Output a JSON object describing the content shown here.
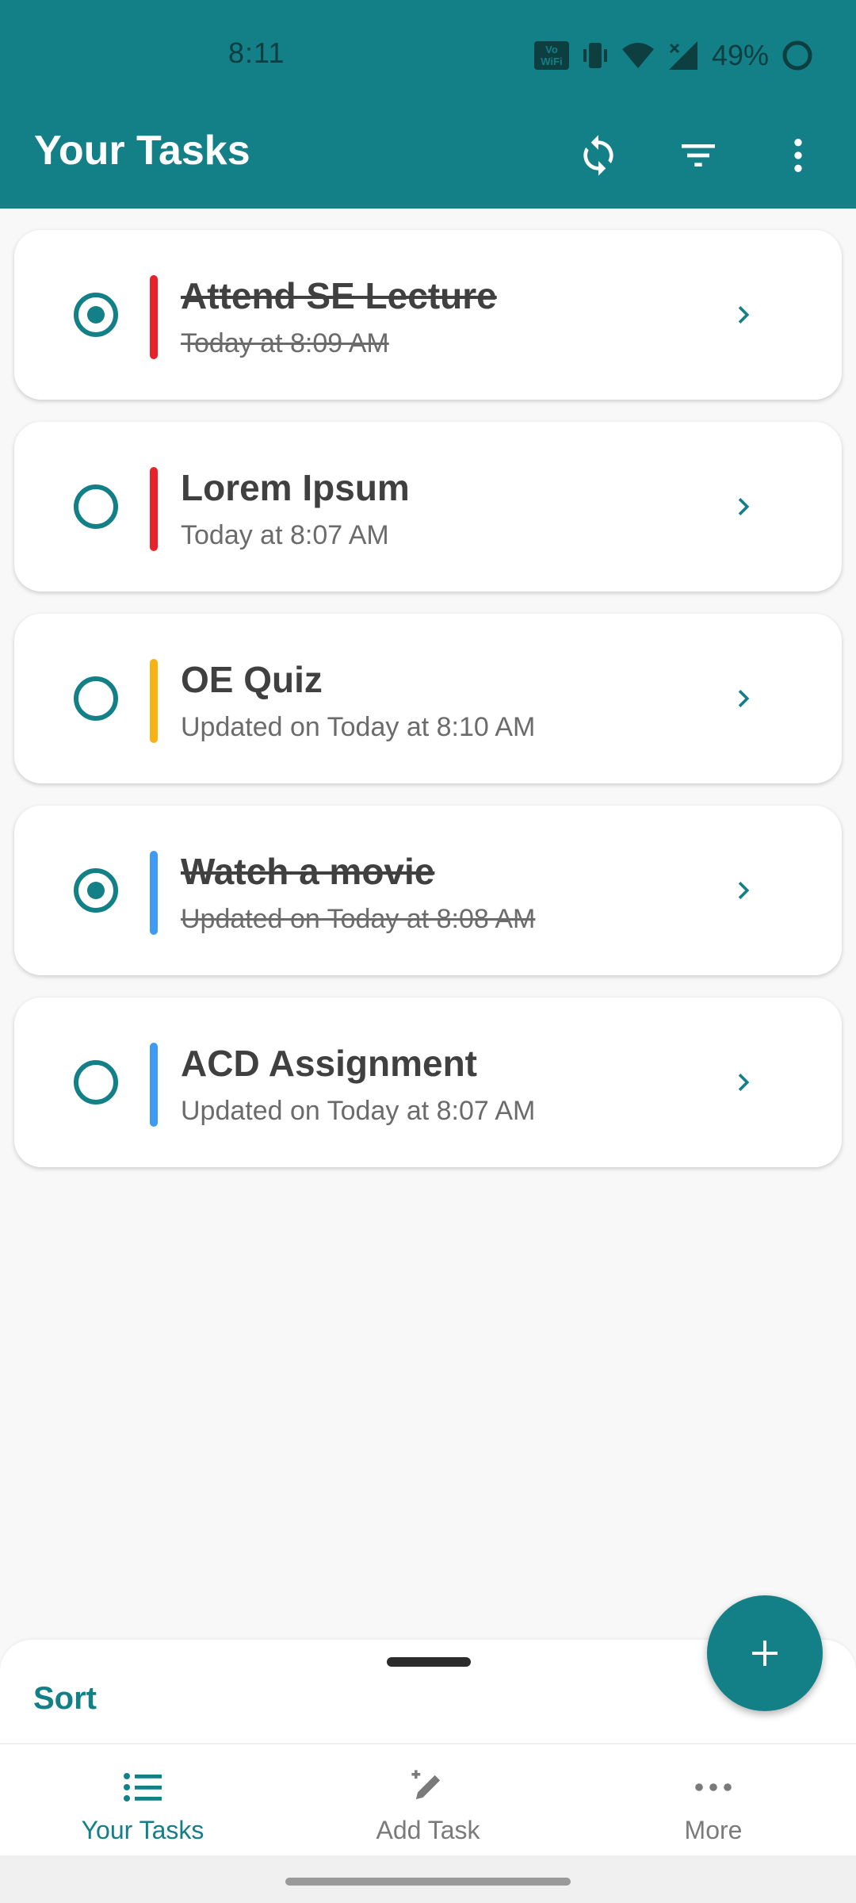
{
  "status_bar": {
    "time": "8:11",
    "battery": "49%",
    "volte_label": "Vo WiFi"
  },
  "toolbar": {
    "title": "Your Tasks",
    "background": "#137f86",
    "icons": [
      "sync-icon",
      "filter-icon",
      "more-vert-icon"
    ]
  },
  "tasks": [
    {
      "title": "Attend SE Lecture",
      "subtitle": "Today at 8:09 AM",
      "done": true,
      "priority_color": "#e8222a"
    },
    {
      "title": "Lorem Ipsum",
      "subtitle": "Today at 8:07 AM",
      "done": false,
      "priority_color": "#e8222a"
    },
    {
      "title": "OE Quiz",
      "subtitle": "Updated on Today at 8:10 AM",
      "done": false,
      "priority_color": "#f5b316"
    },
    {
      "title": "Watch a movie",
      "subtitle": "Updated on Today at 8:08 AM",
      "done": true,
      "priority_color": "#3f9bf2"
    },
    {
      "title": "ACD Assignment",
      "subtitle": "Updated on Today at 8:07 AM",
      "done": false,
      "priority_color": "#3f9bf2"
    }
  ],
  "sheet": {
    "sort_label": "Sort"
  },
  "fab": {
    "icon": "plus-icon"
  },
  "bottom_nav": {
    "items": [
      {
        "label": "Your Tasks",
        "icon": "list-icon",
        "active": true
      },
      {
        "label": "Add Task",
        "icon": "edit-icon",
        "active": false
      },
      {
        "label": "More",
        "icon": "more-horiz-icon",
        "active": false
      }
    ]
  },
  "colors": {
    "accent": "#137f86",
    "high": "#e8222a",
    "medium": "#f5b316",
    "low": "#3f9bf2"
  }
}
